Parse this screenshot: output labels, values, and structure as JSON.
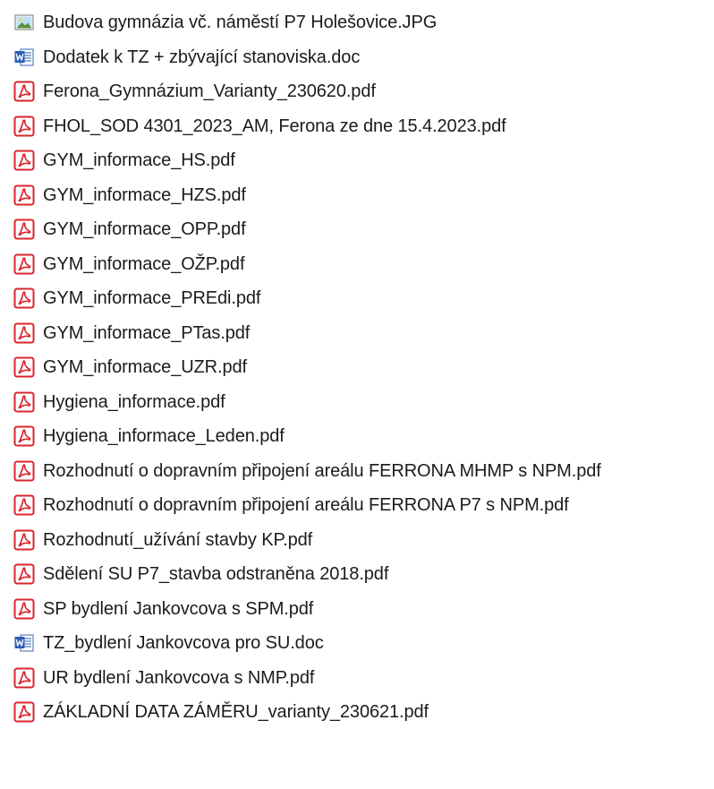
{
  "files": [
    {
      "name": "Budova gymnázia vč. náměstí P7 Holešovice.JPG",
      "icon": "image-file-icon"
    },
    {
      "name": "Dodatek k TZ + zbývající stanoviska.doc",
      "icon": "word-document-icon"
    },
    {
      "name": "Ferona_Gymnázium_Varianty_230620.pdf",
      "icon": "pdf-file-icon"
    },
    {
      "name": "FHOL_SOD 4301_2023_AM, Ferona ze dne 15.4.2023.pdf",
      "icon": "pdf-file-icon"
    },
    {
      "name": "GYM_informace_HS.pdf",
      "icon": "pdf-file-icon"
    },
    {
      "name": "GYM_informace_HZS.pdf",
      "icon": "pdf-file-icon"
    },
    {
      "name": "GYM_informace_OPP.pdf",
      "icon": "pdf-file-icon"
    },
    {
      "name": "GYM_informace_OŽP.pdf",
      "icon": "pdf-file-icon"
    },
    {
      "name": "GYM_informace_PREdi.pdf",
      "icon": "pdf-file-icon"
    },
    {
      "name": "GYM_informace_PTas.pdf",
      "icon": "pdf-file-icon"
    },
    {
      "name": "GYM_informace_UZR.pdf",
      "icon": "pdf-file-icon"
    },
    {
      "name": "Hygiena_informace.pdf",
      "icon": "pdf-file-icon"
    },
    {
      "name": "Hygiena_informace_Leden.pdf",
      "icon": "pdf-file-icon"
    },
    {
      "name": "Rozhodnutí o dopravním připojení areálu FERRONA MHMP s NPM.pdf",
      "icon": "pdf-file-icon"
    },
    {
      "name": "Rozhodnutí o dopravním připojení areálu FERRONA P7 s NPM.pdf",
      "icon": "pdf-file-icon"
    },
    {
      "name": "Rozhodnutí_užívání stavby KP.pdf",
      "icon": "pdf-file-icon"
    },
    {
      "name": "Sdělení SU P7_stavba odstraněna 2018.pdf",
      "icon": "pdf-file-icon"
    },
    {
      "name": "SP bydlení Jankovcova s SPM.pdf",
      "icon": "pdf-file-icon"
    },
    {
      "name": "TZ_bydlení Jankovcova pro SU.doc",
      "icon": "word-document-icon"
    },
    {
      "name": "UR bydlení Jankovcova s NMP.pdf",
      "icon": "pdf-file-icon"
    },
    {
      "name": "ZÁKLADNÍ DATA ZÁMĚRU_varianty_230621.pdf",
      "icon": "pdf-file-icon"
    }
  ],
  "colors": {
    "pdf_red": "#d7262d",
    "word_blue": "#2b5fb4",
    "text": "#1b1b1b"
  }
}
